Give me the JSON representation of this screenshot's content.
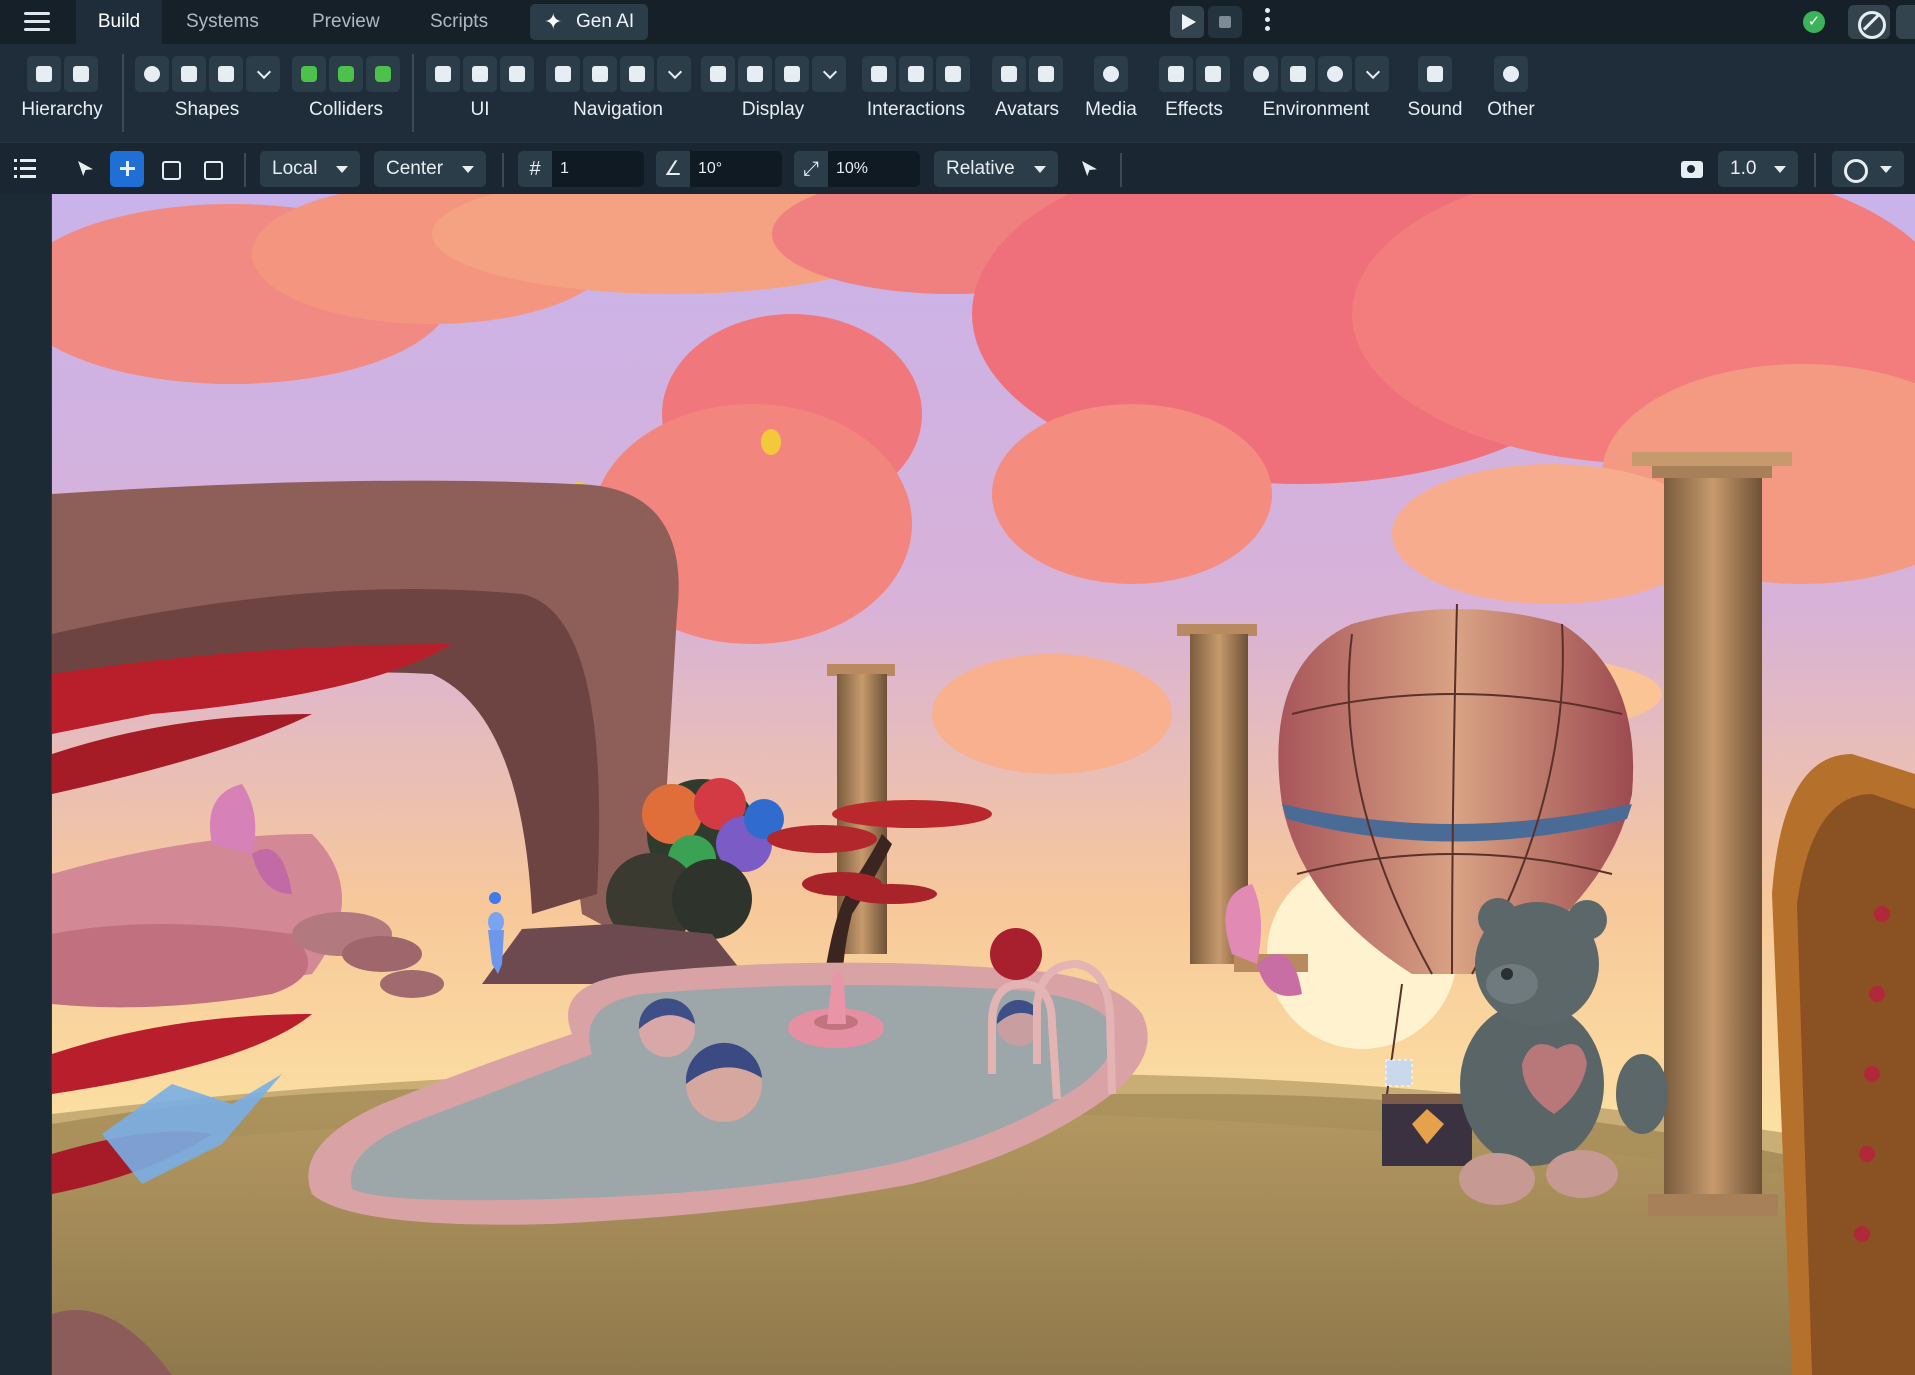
{
  "nav": {
    "tabs": [
      {
        "label": "Build"
      },
      {
        "label": "Systems"
      },
      {
        "label": "Preview"
      },
      {
        "label": "Scripts"
      }
    ],
    "genai_label": "Gen AI"
  },
  "ribbon": {
    "groups": [
      {
        "label": "Hierarchy",
        "icons": [
          "add-object-icon",
          "layers-icon"
        ]
      },
      {
        "label": "Shapes",
        "icons": [
          "sphere-icon",
          "cube-icon",
          "cylinder-icon",
          "chevron-down-icon"
        ]
      },
      {
        "label": "Colliders",
        "icons": [
          "box-collider-icon",
          "sphere-collider-icon",
          "capsule-collider-icon"
        ]
      },
      {
        "label": "UI",
        "icons": [
          "ui-panel-icon",
          "ui-image-icon",
          "text-icon"
        ]
      },
      {
        "label": "Navigation",
        "icons": [
          "spawn-point-icon",
          "door-icon",
          "teleport-icon",
          "chevron-down-icon"
        ]
      },
      {
        "label": "Display",
        "icons": [
          "leaderboard-icon",
          "trophy-icon",
          "billboard-icon",
          "chevron-down-icon"
        ]
      },
      {
        "label": "Interactions",
        "icons": [
          "trigger-icon",
          "grab-icon",
          "proximity-icon"
        ]
      },
      {
        "label": "Avatars",
        "icons": [
          "avatar-icon",
          "npc-icon"
        ]
      },
      {
        "label": "Media",
        "icons": [
          "microphone-icon"
        ]
      },
      {
        "label": "Effects",
        "icons": [
          "sparkle-icon",
          "particles-icon"
        ]
      },
      {
        "label": "Environment",
        "icons": [
          "sun-icon",
          "lightning-icon",
          "cloud-icon",
          "chevron-down-icon"
        ]
      },
      {
        "label": "Sound",
        "icons": [
          "speaker-icon"
        ]
      },
      {
        "label": "Other",
        "icons": [
          "other-components-icon"
        ]
      }
    ]
  },
  "toolbar": {
    "space": "Local",
    "pivot": "Center",
    "grid_snap": "1",
    "rotate_snap": "10°",
    "scale_snap": "10%",
    "snap_mode": "Relative",
    "camera_speed": "1.0"
  },
  "colors": {
    "active_tab_bg": "#1e2d39",
    "accent_blue": "#1f6fd6",
    "status_green": "#3cb35a",
    "collider_green": "#4cc24a"
  },
  "scene": {
    "objects": [
      "rock-arch",
      "pool",
      "beach-ball",
      "pool-float",
      "pool-ladder",
      "hot-air-balloon",
      "teddy-bear",
      "greek-column",
      "ornate-door",
      "spawn-point",
      "butterfly",
      "star-tree",
      "bonsai-tree",
      "coin",
      "clouds"
    ]
  }
}
